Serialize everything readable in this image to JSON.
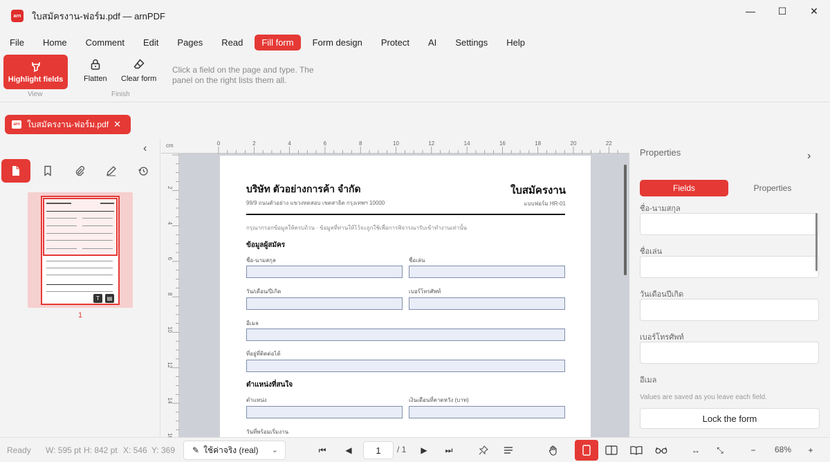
{
  "window": {
    "title": "ใบสมัครงาน-ฟอร์ม.pdf — arnPDF",
    "logo_text": "arn",
    "minimize": "—",
    "maximize": "☐",
    "close": "✕"
  },
  "menu": [
    "File",
    "Home",
    "Comment",
    "Edit",
    "Pages",
    "Read",
    "Fill form",
    "Form design",
    "Protect",
    "AI",
    "Settings",
    "Help"
  ],
  "menu_active": "Fill form",
  "ribbon": {
    "highlight_label": "Highlight fields",
    "view_group": "View",
    "flatten_label": "Flatten",
    "clear_label": "Clear form",
    "finish_group": "Finish",
    "hint": "Click a field on the page and type. The panel on the right lists them all."
  },
  "doc_tab": {
    "name": "ใบสมัครงาน-ฟอร์ม.pdf",
    "close": "✕"
  },
  "left_panel": {
    "collapse": "‹",
    "page_number": "1",
    "badges": [
      "T",
      "▤"
    ]
  },
  "ruler": {
    "unit": "cm",
    "top_labels": [
      "0",
      "2",
      "4",
      "6",
      "8",
      "10",
      "12",
      "14",
      "16",
      "18",
      "20",
      "22"
    ],
    "left_labels": [
      "2",
      "4",
      "6",
      "8",
      "10",
      "12",
      "14",
      "16"
    ]
  },
  "pdf_page": {
    "company": "บริษัท ตัวอย่างการค้า จำกัด",
    "title": "ใบสมัครงาน",
    "address": "99/9 ถนนตัวอย่าง แขวงทดสอบ เขตสาธิต กรุงเทพฯ 10000",
    "form_no": "แบบฟอร์ม HR-01",
    "note": "กรุณากรอกข้อมูลให้ครบถ้วน · ข้อมูลที่ท่านให้ไว้จะถูกใช้เพื่อการพิจารณารับเข้าทำงานเท่านั้น",
    "section1": "ข้อมูลผู้สมัคร",
    "section2": "ตำแหน่งที่สนใจ",
    "labels": {
      "fullname": "ชื่อ-นามสกุล",
      "nickname": "ชื่อเล่น",
      "birthdate": "วัน/เดือน/ปีเกิด",
      "phone": "เบอร์โทรศัพท์",
      "email": "อีเมล",
      "address": "ที่อยู่ที่ติดต่อได้",
      "position": "ตำแหน่ง",
      "salary": "เงินเดือนที่คาดหวัง (บาท)",
      "start": "วันที่พร้อมเริ่มงาน"
    }
  },
  "right_panel": {
    "title": "Properties",
    "chevron": "›",
    "seg_fields": "Fields",
    "seg_properties": "Properties",
    "fields": [
      "ชื่อ-นามสกุล",
      "ชื่อเล่น",
      "วันเดือนปีเกิด",
      "เบอร์โทรศัพท์",
      "อีเมล"
    ],
    "hint": "Values are saved as you leave each field.",
    "lock_button": "Lock the form"
  },
  "status": {
    "ready": "Ready",
    "width": "W: 595 pt",
    "height": "H: 842 pt",
    "x": "X: 546",
    "y": "Y: 369",
    "mode": "ใช้ค่าจริง (real)",
    "page": "1",
    "total": "/ 1",
    "zoom": "68%"
  },
  "colors": {
    "accent": "#e53935",
    "field_fill": "#e9edf8",
    "field_border": "#7f8eac"
  }
}
